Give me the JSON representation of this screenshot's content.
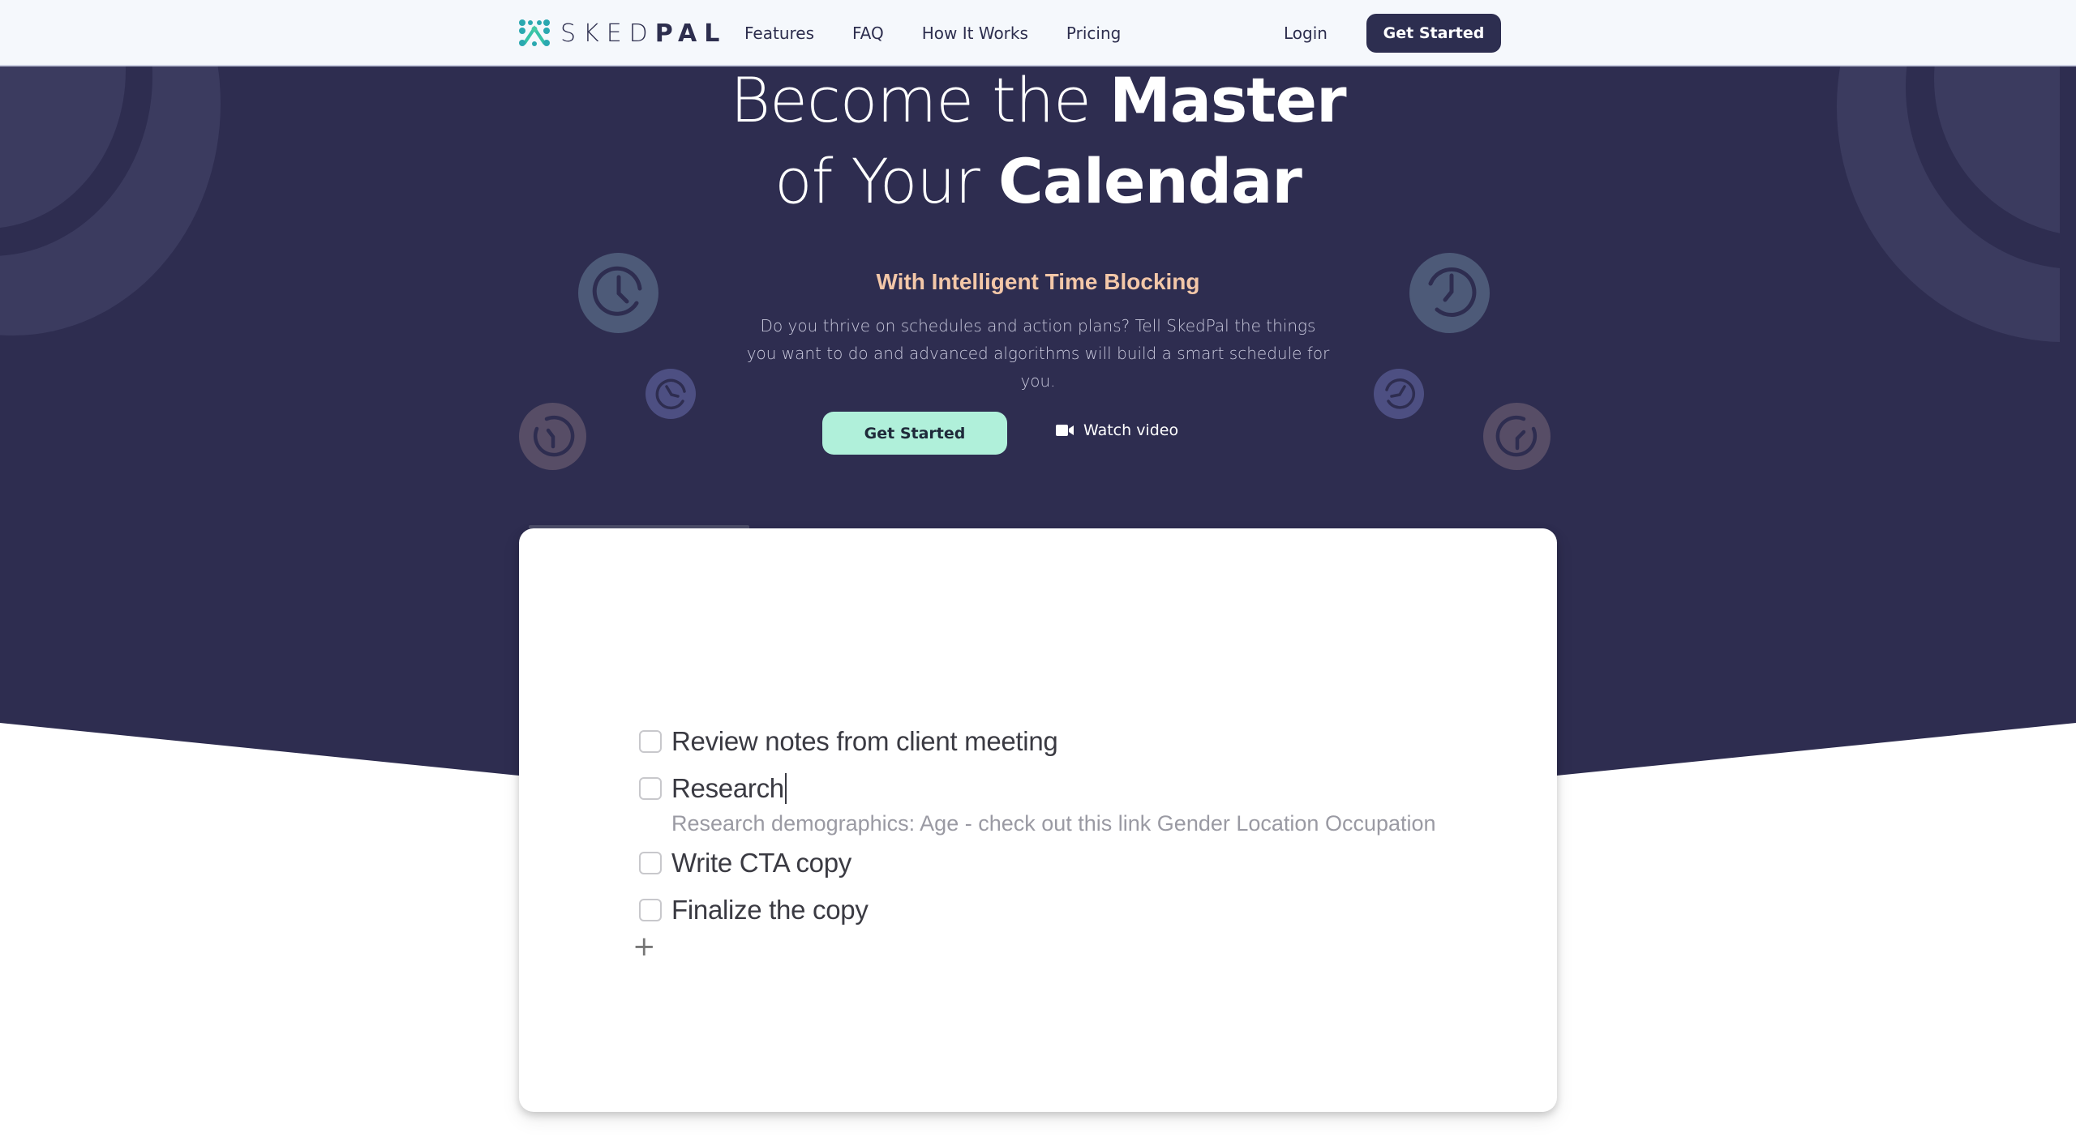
{
  "navbar": {
    "logo": {
      "light": "SKED",
      "bold": "PAL"
    },
    "links": [
      "Features",
      "FAQ",
      "How It Works",
      "Pricing"
    ],
    "login_label": "Login",
    "cta_label": "Get Started"
  },
  "hero": {
    "title_line1_light": "Become the ",
    "title_line1_bold": "Master",
    "title_line2_light": "of Your ",
    "title_line2_bold": "Calendar",
    "subtitle": "With Intelligent Time Blocking",
    "description": "Do you thrive on schedules and action plans? Tell SkedPal the things you want to do and advanced algorithms will build a smart schedule for you.",
    "cta_label": "Get Started",
    "watch_video_label": "Watch video",
    "watch_video_icon": "video-camera-icon"
  },
  "demo": {
    "tasks": [
      {
        "text": "Review notes from client meeting",
        "checked": false
      },
      {
        "text": "Research",
        "checked": false,
        "editing": true,
        "note": "Research demographics: Age - check out this link Gender Location Occupation"
      },
      {
        "text": "Write CTA copy",
        "checked": false
      },
      {
        "text": "Finalize the copy",
        "checked": false
      }
    ],
    "add_label": "+"
  },
  "colors": {
    "hero_bg": "#2e2d50",
    "nav_bg": "#f5f8fc",
    "accent_mint": "#b0f0da",
    "subtitle_peach": "#f3c7a8",
    "logo_teal": "#2aa8b0"
  }
}
